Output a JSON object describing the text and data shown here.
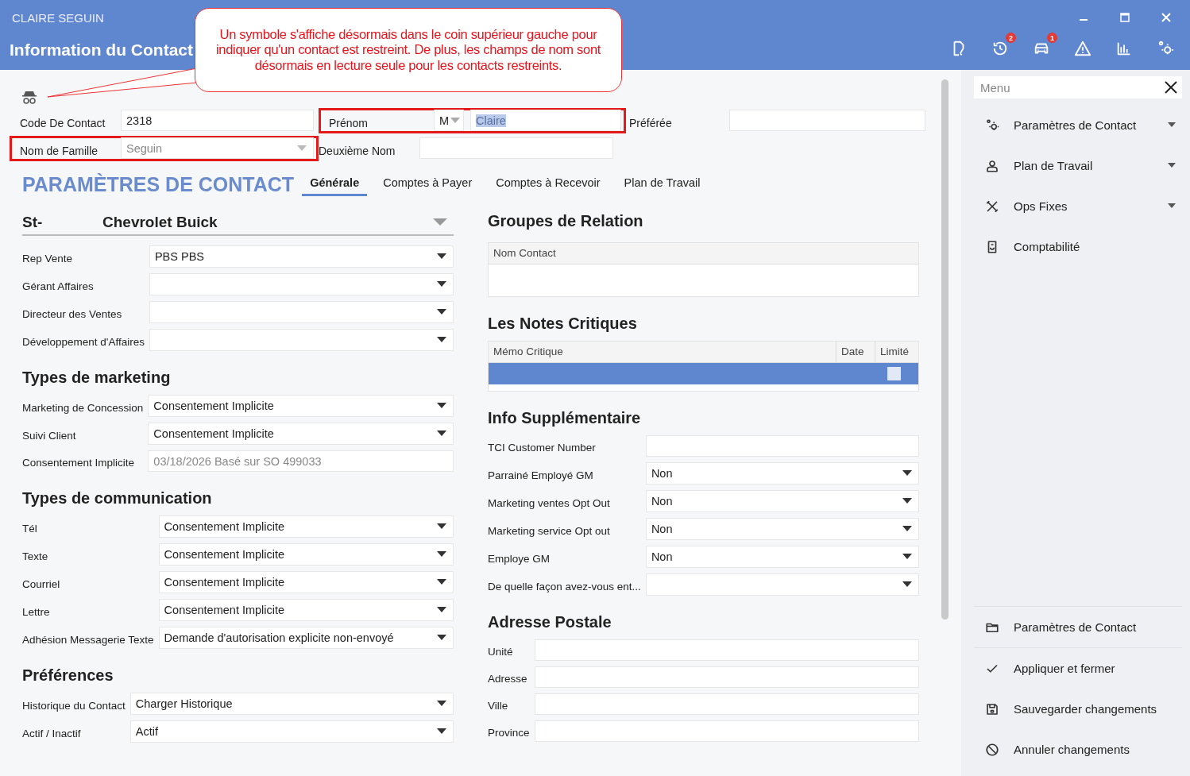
{
  "window": {
    "user": "CLAIRE SEGUIN",
    "title": "Information du Contact"
  },
  "toolbar": [
    {
      "kind": "document"
    },
    {
      "kind": "history",
      "badge": "2"
    },
    {
      "kind": "car",
      "badge": "1"
    },
    {
      "kind": "warning"
    },
    {
      "kind": "chart"
    },
    {
      "kind": "settings"
    }
  ],
  "callout": {
    "text": "Un symbole s'affiche désormais dans le coin supérieur gauche pour indiquer qu'un contact est restreint. De plus, les champs de nom sont désormais en lecture seule pour les contacts restreints."
  },
  "restricted": true,
  "fields": {
    "code": {
      "label": "Code De Contact",
      "value": "2318"
    },
    "first_name": {
      "label": "Prénom",
      "title": "M",
      "value": "Claire",
      "highlighted": true,
      "text_selected": true
    },
    "preferred": {
      "label": "Préférée"
    },
    "last_name": {
      "label": "Nom de Famille",
      "value": "Seguin",
      "highlighted": true,
      "read_only": true
    },
    "middle_name": {
      "label": "Deuxième Nom"
    }
  },
  "heading": "PARAMÈTRES DE CONTACT",
  "tabs": [
    {
      "label": "Générale",
      "selected": true
    },
    {
      "label": "Comptes à Payer",
      "selected": false
    },
    {
      "label": "Comptes à Recevoir",
      "selected": false
    },
    {
      "label": "Plan de Travail",
      "selected": false
    }
  ],
  "dealer": {
    "prefix": "St-",
    "name": "Chevrolet Buick"
  },
  "left_sections": [
    {
      "rows": [
        {
          "label": "Rep Vente",
          "value": "PBS PBS",
          "kind": "select"
        },
        {
          "label": "Gérant Affaires",
          "kind": "select"
        },
        {
          "label": "Directeur des Ventes",
          "kind": "select"
        },
        {
          "label": "Développement d'Affaires",
          "kind": "select"
        }
      ]
    },
    {
      "title": "Types de marketing",
      "rows": [
        {
          "label": "Marketing de Concession",
          "value": "Consentement Implicite",
          "kind": "select"
        },
        {
          "label": "Suivi Client",
          "value": "Consentement Implicite",
          "kind": "select"
        },
        {
          "label": "Consentement Implicite",
          "value": "03/18/2026 Basé sur SO 499033",
          "kind": "readonly"
        }
      ]
    },
    {
      "title": "Types de communication",
      "rows": [
        {
          "label": "Tél",
          "value": "Consentement Implicite",
          "kind": "select"
        },
        {
          "label": "Texte",
          "value": "Consentement Implicite",
          "kind": "select"
        },
        {
          "label": "Courriel",
          "value": "Consentement Implicite",
          "kind": "select"
        },
        {
          "label": "Lettre",
          "value": "Consentement Implicite",
          "kind": "select"
        },
        {
          "label": "Adhésion Messagerie Texte",
          "value": "Demande d'autorisation explicite non-envoyé",
          "kind": "select"
        }
      ]
    },
    {
      "title": "Préférences",
      "rows": [
        {
          "label": "Historique du Contact",
          "value": "Charger Historique",
          "kind": "select"
        },
        {
          "label": "Actif / Inactif",
          "value": "Actif",
          "kind": "select"
        }
      ]
    }
  ],
  "relation_groups": {
    "title": "Groupes de Relation",
    "columns": [
      "Nom Contact"
    ]
  },
  "critical_notes": {
    "title": "Les Notes Critiques",
    "columns": [
      "Mémo Critique",
      "Date",
      "Limité"
    ],
    "rows": [
      {
        "selected": true,
        "limit_checked": false
      }
    ]
  },
  "right_sections": [
    {
      "title": "Info Supplémentaire",
      "rows": [
        {
          "label": "TCI Customer Number",
          "kind": "text"
        },
        {
          "label": "Parrainé Employé GM",
          "value": "Non",
          "kind": "select"
        },
        {
          "label": "Marketing ventes Opt Out",
          "value": "Non",
          "kind": "select"
        },
        {
          "label": "Marketing service Opt out",
          "value": "Non",
          "kind": "select"
        },
        {
          "label": "Employe GM",
          "value": "Non",
          "kind": "select"
        },
        {
          "label": "De quelle façon avez-vous ent...",
          "kind": "select"
        }
      ]
    },
    {
      "title": "Adresse Postale",
      "rows": [
        {
          "label": "Unité",
          "kind": "text"
        },
        {
          "label": "Adresse",
          "kind": "text"
        },
        {
          "label": "Ville",
          "kind": "text"
        },
        {
          "label": "Province",
          "kind": "text"
        }
      ]
    }
  ],
  "menu": {
    "placeholder": "Menu",
    "items": [
      {
        "kind": "settings",
        "label": "Paramètres de Contact",
        "expanded": false
      },
      {
        "kind": "person",
        "label": "Plan de Travail",
        "expanded": false
      },
      {
        "kind": "tools",
        "label": "Ops Fixes",
        "expanded": false
      },
      {
        "kind": "ledger",
        "label": "Comptabilité"
      }
    ],
    "actions": [
      {
        "kind": "folder",
        "label": "Paramètres de Contact"
      },
      {
        "kind": "check",
        "label": "Appliquer et fermer"
      },
      {
        "kind": "save",
        "label": "Sauvegarder changements"
      },
      {
        "kind": "cancel",
        "label": "Annuler changements"
      }
    ]
  }
}
